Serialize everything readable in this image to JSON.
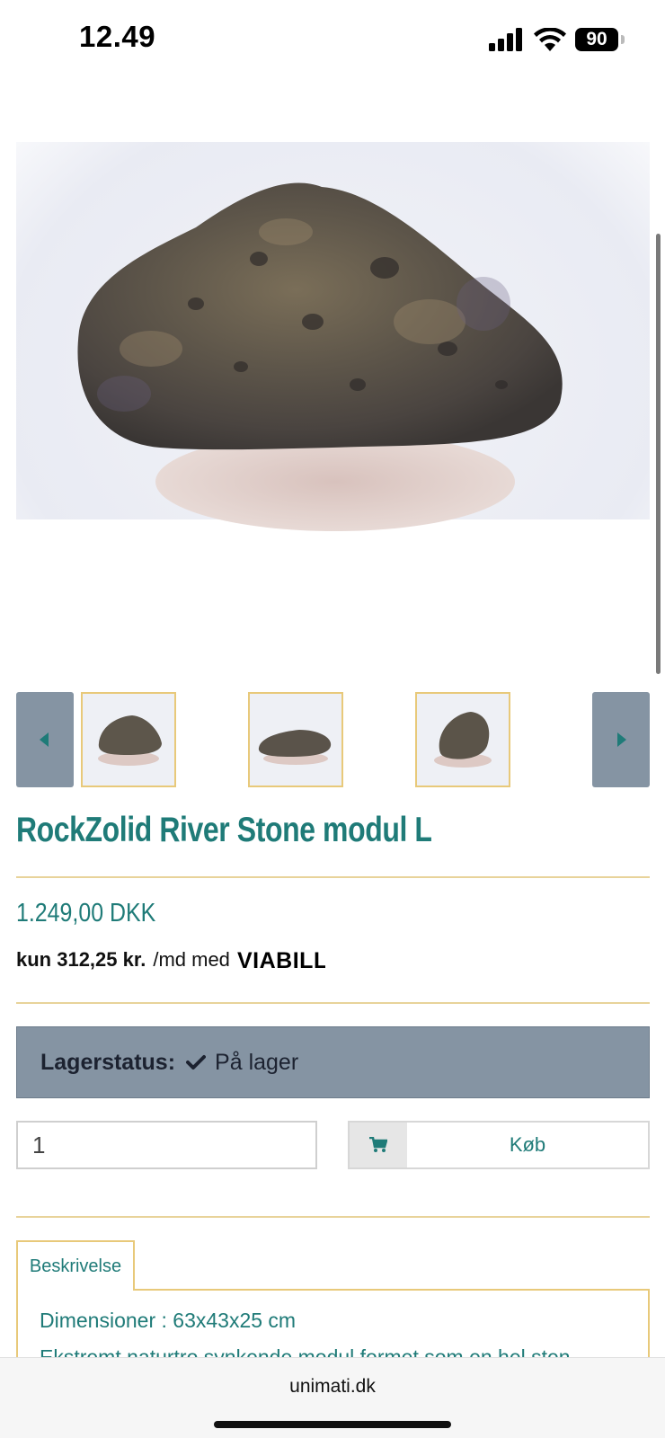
{
  "status_bar": {
    "time": "12.49",
    "battery": "90",
    "icons": [
      "cellular-signal-icon",
      "wifi-icon",
      "battery-icon"
    ]
  },
  "product": {
    "images": [
      "rock-front",
      "rock-flat",
      "rock-upright"
    ],
    "title": "RockZolid River Stone modul L",
    "price": "1.249,00 DKK",
    "financing": {
      "prefix": "kun 312,25 kr.",
      "suffix": "/md med",
      "provider": "VIABILL"
    },
    "stock": {
      "label": "Lagerstatus:",
      "value": "På lager"
    },
    "quantity": "1",
    "buy_label": "Køb"
  },
  "tabs": [
    {
      "label": "Beskrivelse",
      "active": true
    }
  ],
  "description": {
    "dimensions": "Dimensioner : 63x43x25 cm",
    "text": "Ekstremt naturtro synkende modul formet som en hel sten"
  },
  "browser": {
    "url": "unimati.dk"
  },
  "colors": {
    "accent": "#1f7b78",
    "rule": "#e8d39a",
    "stock_bg": "#8594a3",
    "thumb_border": "#e8c97a"
  }
}
